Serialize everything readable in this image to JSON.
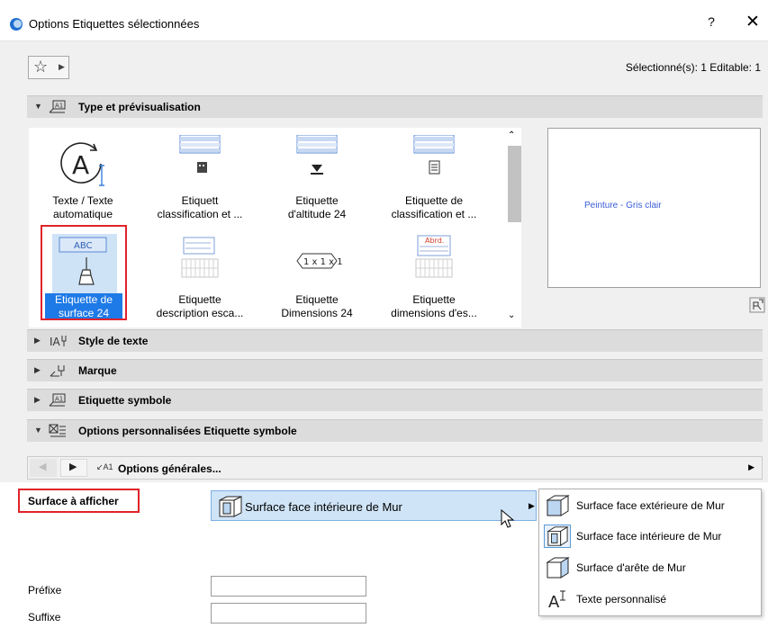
{
  "window": {
    "title": "Options Etiquettes sélectionnées",
    "help": "?",
    "close": "✕"
  },
  "toolbar": {
    "favorites_icon": "star-icon",
    "selection_info": "Sélectionné(s): 1 Editable: 1"
  },
  "panels": [
    {
      "title": "Type et prévisualisation",
      "expanded": true
    },
    {
      "title": "Style de texte",
      "expanded": false
    },
    {
      "title": "Marque",
      "expanded": false
    },
    {
      "title": "Etiquette symbole",
      "expanded": false
    },
    {
      "title": "Options personnalisées Etiquette symbole",
      "expanded": true
    }
  ],
  "library": {
    "items": [
      {
        "label1": "Texte / Texte",
        "label2": "automatique"
      },
      {
        "label1": "Etiquett",
        "label2": "classification et ..."
      },
      {
        "label1": "Etiquette",
        "label2": "d'altitude 24"
      },
      {
        "label1": "Etiquette de",
        "label2": "classification et ..."
      },
      {
        "label1": "Etiquette de",
        "label2": "surface 24",
        "selected": true
      },
      {
        "label1": "Etiquette",
        "label2": "description esca..."
      },
      {
        "label1": "Etiquette",
        "label2": "Dimensions 24"
      },
      {
        "label1": "Etiquette",
        "label2": "dimensions d'es..."
      }
    ],
    "thumb_texts": {
      "surface": "ABC",
      "dimensions": "1 x 1 x 1",
      "abrd": "Abrd."
    }
  },
  "preview": {
    "text": "Peinture - Gris clair"
  },
  "subnav": {
    "title": "Options générales..."
  },
  "form": {
    "surface_label": "Surface à afficher",
    "surface_value": "Surface face intérieure de Mur",
    "prefix_label": "Préfixe",
    "suffix_label": "Suffixe",
    "prefix_value": "",
    "suffix_value": ""
  },
  "popup": {
    "items": [
      {
        "label": "Surface face extérieure de Mur"
      },
      {
        "label": "Surface face intérieure de Mur",
        "current": true
      },
      {
        "label": "Surface d'arête de Mur"
      },
      {
        "label": "Texte personnalisé"
      }
    ]
  },
  "colors": {
    "accent": "#1e7ae6",
    "highlight_outline": "#e0232a",
    "preview_text": "#3b5cd8"
  }
}
